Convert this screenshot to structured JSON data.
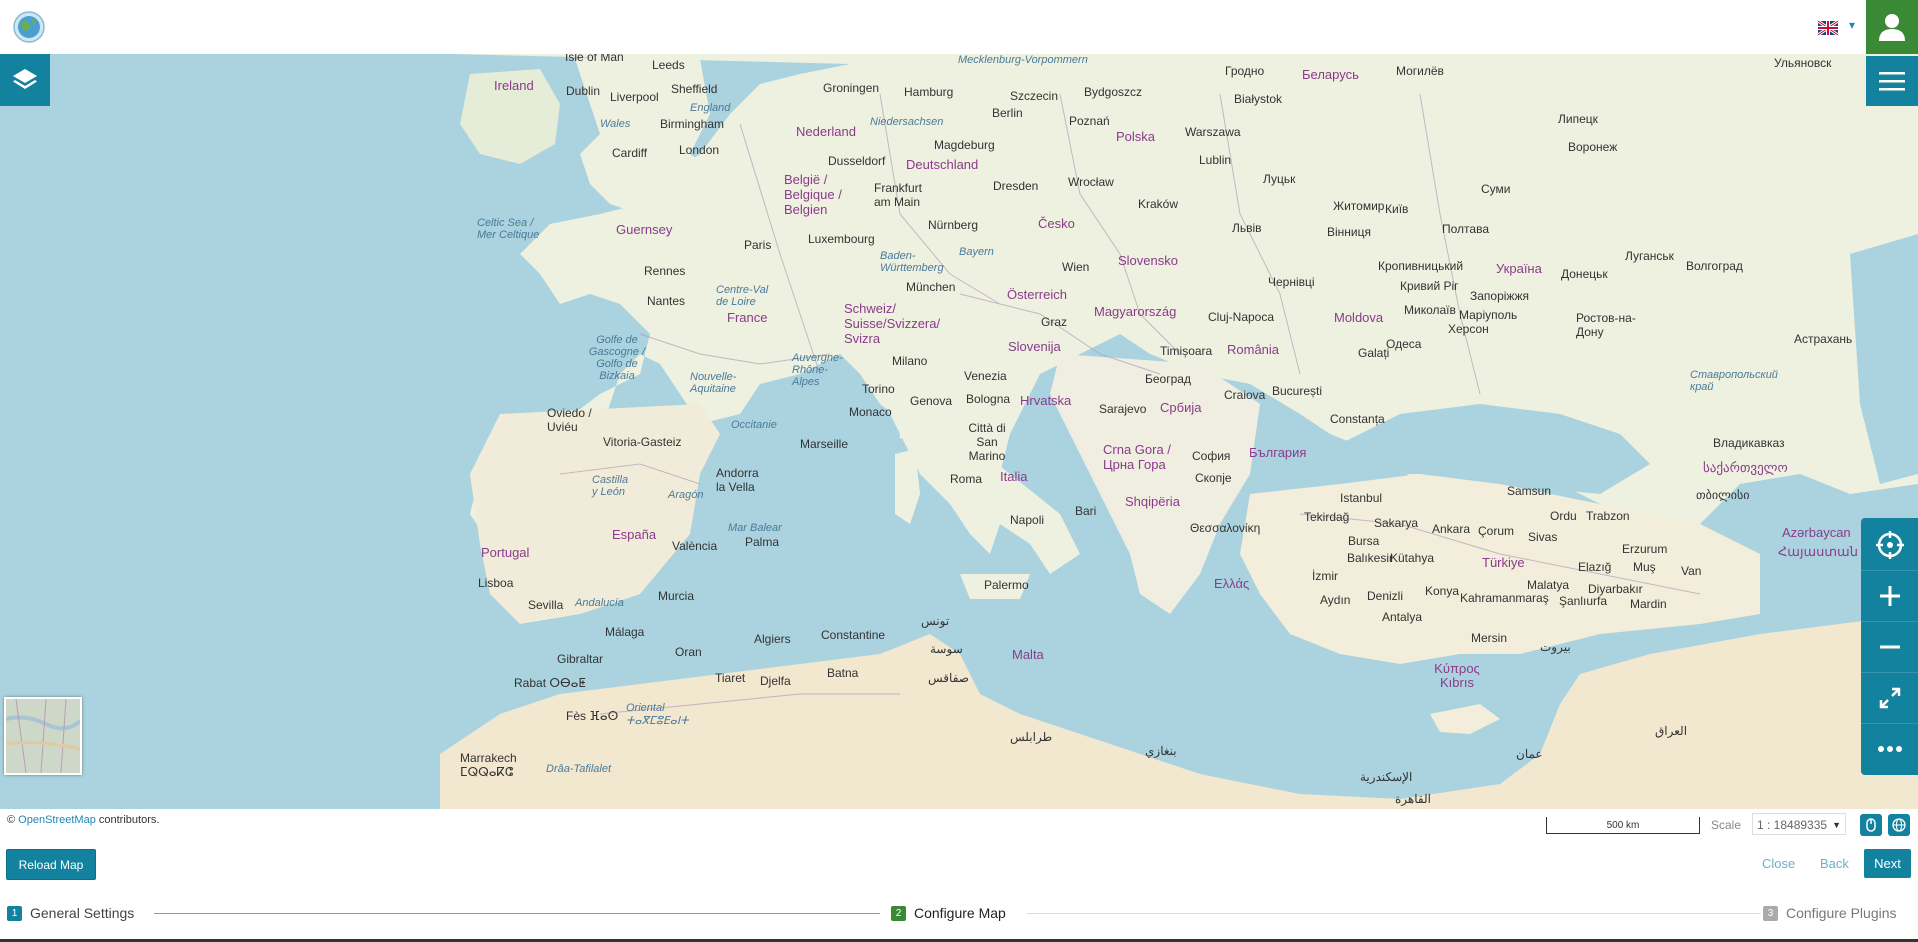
{
  "header": {
    "logo_icon": "globe-logo-icon",
    "language_icon": "uk-flag-icon",
    "user_icon": "user-icon",
    "accent_color": "#3a8a35"
  },
  "map": {
    "labels": {
      "isle_of_man": "Isle of Man",
      "leeds": "Leeds",
      "ireland": "Ireland",
      "dublin": "Dublin",
      "liverpool": "Liverpool",
      "sheffield": "Sheffield",
      "england": "England",
      "wales": "Wales",
      "birmingham": "Birmingham",
      "cardiff": "Cardiff",
      "london": "London",
      "groningen": "Groningen",
      "hamburg": "Hamburg",
      "mecklenburg": "Mecklenburg-Vorpommern",
      "szczecin": "Szczecin",
      "bydgoszcz": "Bydgoszcz",
      "grodno": "Гродно",
      "belarus": "Беларусь",
      "mogilev": "Могилёв",
      "ulyanovsk": "Ульяновск",
      "nederland": "Nederland",
      "niedersachsen": "Niedersachsen",
      "berlin": "Berlin",
      "poznan": "Poznań",
      "bialystok": "Białystok",
      "polska": "Polska",
      "warszawa": "Warszawa",
      "lipetsk": "Липецк",
      "voronezh": "Воронеж",
      "magdeburg": "Magdeburg",
      "dusseldorf": "Dusseldorf",
      "deutschland": "Deutschland",
      "lublin": "Lublin",
      "belgie": "België / Belgique / Belgien",
      "frankfurt": "Frankfurt am Main",
      "dresden": "Dresden",
      "wroclaw": "Wrocław",
      "lutsk": "Луцьк",
      "sumy": "Суми",
      "celtic_sea": "Celtic Sea / Mer Celtique",
      "guernsey": "Guernsey",
      "luxembourg": "Luxembourg",
      "nurnberg": "Nürnberg",
      "cesko": "Česko",
      "krakow": "Kraków",
      "zhytomyr": "Житомир",
      "kyiv": "Київ",
      "lviv": "Львів",
      "vinnytsia": "Вінниця",
      "poltava": "Полтава",
      "paris": "Paris",
      "baden": "Baden-Württemberg",
      "bayern": "Bayern",
      "wien": "Wien",
      "slovensko": "Slovensko",
      "kropyvnytskyi": "Кропивницький",
      "ukraina": "Україна",
      "luhansk": "Луганськ",
      "volgograd": "Волгоград",
      "rennes": "Rennes",
      "munchen": "München",
      "osterreich": "Österreich",
      "chernivtsi": "Чернівці",
      "kryvyi_rih": "Кривий Ріг",
      "zaporizhzhia": "Запоріжжя",
      "donetsk": "Донецьк",
      "nantes": "Nantes",
      "centre": "Centre-Val de Loire",
      "france": "France",
      "schweiz": "Schweiz/ Suisse/Svizzera/ Svizra",
      "graz": "Graz",
      "magyarorszag": "Magyarország",
      "cluj": "Cluj-Napoca",
      "moldova": "Moldova",
      "mykolaiv": "Миколаїв",
      "mariupol": "Маріуполь",
      "rostov": "Ростов-на-Дону",
      "kherson": "Херсон",
      "astrakhan": "Астрахань",
      "golfe": "Golfe de Gascogne / Golfo de Bizkaia",
      "auvergne": "Auvergne-Rhône-Alpes",
      "milano": "Milano",
      "slovenija": "Slovenija",
      "timisoara": "Timișoara",
      "romania": "România",
      "galati": "Galați",
      "odesa": "Одеса",
      "nouvelle": "Nouvelle-Aquitaine",
      "venezia": "Venezia",
      "torino": "Torino",
      "beograd": "Београд",
      "bologna": "Bologna",
      "hrvatska": "Hrvatska",
      "craiova": "Craiova",
      "bucuresti": "București",
      "stavropol": "Ставропольский край",
      "genova": "Genova",
      "monaco": "Monaco",
      "sarajevo": "Sarajevo",
      "srbija": "Србија",
      "occitanie": "Occitanie",
      "oviedo": "Oviedo / Uviéu",
      "vitoria": "Vitoria-Gasteiz",
      "marseille": "Marseille",
      "citta": "Città di San Marino",
      "constanta": "Constanța",
      "crna_gora": "Crna Gora / Црна Гора",
      "bulgaria": "България",
      "sofia": "София",
      "vladikavkaz": "Владикавказ",
      "andorra": "Andorra la Vella",
      "roma": "Roma",
      "italia": "Italia",
      "skopje": "Скопје",
      "sakartvelo": "საქართველო",
      "castilla": "Castilla y León",
      "aragon": "Aragón",
      "shqiperia": "Shqipëria",
      "istanbul": "Istanbul",
      "samsun": "Samsun",
      "bari": "Bari",
      "thessaloniki": "Θεσσαλονίκη",
      "ordu": "Ordu",
      "trabzon": "Trabzon",
      "tbilisi": "თბილისი",
      "napoli": "Napoli",
      "tekirdag": "Tekirdağ",
      "sakarya": "Sakarya",
      "ankara": "Ankara",
      "corum": "Çorum",
      "sivas": "Sivas",
      "azarbaycan": "Azərbaycan",
      "espana": "España",
      "mar_balear": "Mar Balear",
      "palma": "Palma",
      "valencia": "València",
      "bursa": "Bursa",
      "erzurum": "Erzurum",
      "hayastan": "Հայաստան",
      "portugal": "Portugal",
      "balikesir": "Balıkesir",
      "kutahya": "Kütahya",
      "turkiye": "Türkiye",
      "elazig": "Elazığ",
      "mus": "Muş",
      "izmir": "İzmir",
      "van": "Van",
      "lisboa": "Lisboa",
      "ellas": "Ελλάς",
      "palermo": "Palermo",
      "murcia": "Murcia",
      "konya": "Konya",
      "malatya": "Malatya",
      "diyarbakir": "Diyarbakır",
      "sevilla": "Sevilla",
      "andalucia": "Andalucía",
      "aydin": "Aydın",
      "denizli": "Denizli",
      "kahramanmaras": "Kahramanmaraş",
      "sanliurfa": "Şanlıurfa",
      "mardin": "Mardin",
      "tunis": "تونس",
      "malaga": "Málaga",
      "algiers": "Algiers",
      "constantine": "Constantine",
      "antalya": "Antalya",
      "gibraltar": "Gibraltar",
      "oran": "Oran",
      "sousse": "سوسة",
      "mersin": "Mersin",
      "tiaret": "Tiaret",
      "djelfa": "Djelfa",
      "batna": "Batna",
      "malta": "Malta",
      "sfax": "صفاقس",
      "kypros": "Κύπρος Kıbrıs",
      "rabat": "Rabat ⵔⴱⴰⵟ",
      "fes": "Fès ⴼⴰⵙ",
      "oriental": "Oriental ⵜⴰⴳⵎⵓⴹⴰⵏⵜ",
      "tripoli": "طرابلس",
      "marrakech": "Marrakech ⵎⵕⵕⴰⴽⵛ",
      "draa": "Drâa-Tafilalet",
      "iraq": "العراق",
      "beirut": "بيروت",
      "amman": "عمان",
      "alexandria": "الإسكندرية",
      "cairo": "القاهرة",
      "benghazi": "بنغازي"
    }
  },
  "attribution": {
    "prefix": "©",
    "link": "OpenStreetMap",
    "suffix": "contributors."
  },
  "scale": {
    "bar_label": "500 km",
    "label": "Scale",
    "value": "1 : 18489335"
  },
  "toolbar": {
    "reload_label": "Reload Map",
    "close_label": "Close",
    "back_label": "Back",
    "next_label": "Next"
  },
  "steps": [
    {
      "num": "1",
      "label": "General Settings",
      "color": "#13829e"
    },
    {
      "num": "2",
      "label": "Configure Map",
      "color": "#3a8a35"
    },
    {
      "num": "3",
      "label": "Configure Plugins",
      "color": "#aaaaaa"
    }
  ],
  "colors": {
    "primary": "#13829e",
    "sea": "#aad3df",
    "land": "#f2efe9"
  }
}
